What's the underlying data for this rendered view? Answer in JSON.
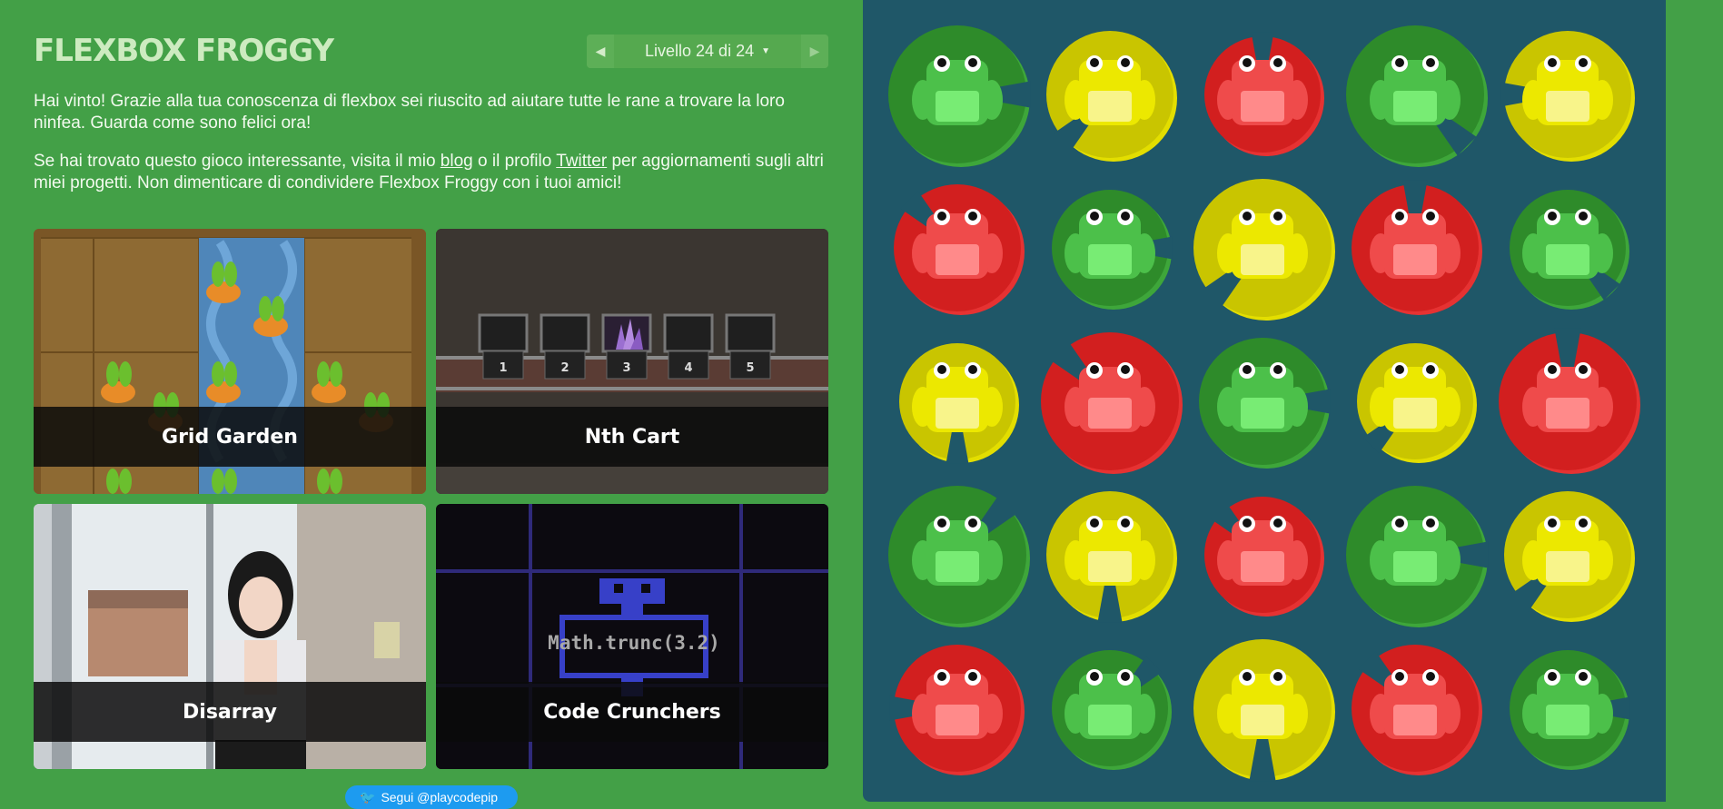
{
  "header": {
    "title": "FLEXBOX FROGGY",
    "level_label": "Livello 24 di 24"
  },
  "intro": {
    "p1": "Hai vinto! Grazie alla tua conoscenza di flexbox sei riuscito ad aiutare tutte le rane a trovare la loro ninfea. Guarda come sono felici ora!",
    "p2_before_blog": "Se hai trovato questo gioco interessante, visita il mio ",
    "blog_link": "blog",
    "p2_between": " o il profilo ",
    "twitter_link": "Twitter",
    "p2_after": " per aggiornamenti sugli altri miei progetti. Non dimenticare di condividere Flexbox Froggy con i tuoi amici!"
  },
  "games": [
    {
      "name": "Grid Garden"
    },
    {
      "name": "Nth Cart"
    },
    {
      "name": "Disarray"
    },
    {
      "name": "Code Crunchers"
    }
  ],
  "nth_cart_numbers": [
    "1",
    "2",
    "3",
    "4",
    "5"
  ],
  "code_crunchers_snippet": "Math.trunc(3.2)",
  "follow_button": "Segui @playcodepip",
  "colors": {
    "background": "#43a047",
    "board": "#1f5768",
    "green": "#2e8b2a",
    "yellow": "#c9c500",
    "red": "#d21f1f"
  },
  "grid": [
    [
      "green",
      "yellow",
      "red",
      "green",
      "yellow"
    ],
    [
      "red",
      "green",
      "yellow",
      "red",
      "green"
    ],
    [
      "yellow",
      "red",
      "green",
      "yellow",
      "red"
    ],
    [
      "green",
      "yellow",
      "red",
      "green",
      "yellow"
    ],
    [
      "red",
      "green",
      "yellow",
      "red",
      "green"
    ]
  ]
}
